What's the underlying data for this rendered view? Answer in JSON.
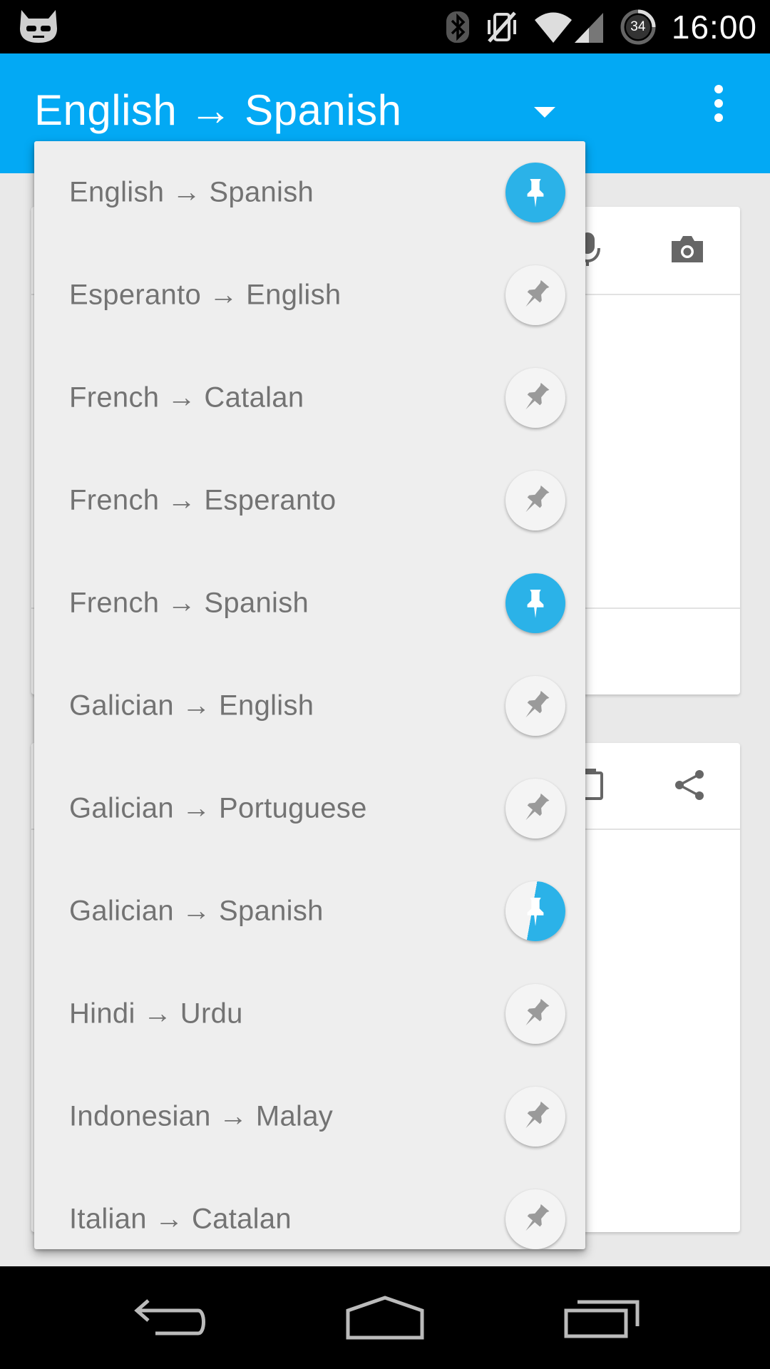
{
  "status_bar": {
    "time": "16:00",
    "battery_level": "34",
    "icons": [
      "cyanogenmod-icon",
      "bluetooth-icon",
      "vibrate-off-icon",
      "wifi-icon",
      "signal-icon",
      "battery-icon"
    ]
  },
  "toolbar": {
    "title": "English → Spanish",
    "background": "#03a9f4"
  },
  "input_card": {
    "icons": [
      "microphone-icon",
      "camera-icon"
    ]
  },
  "output_card": {
    "icons": [
      "copy-icon",
      "share-icon"
    ]
  },
  "dropdown": {
    "items": [
      {
        "label": "English → Spanish",
        "pinned": true
      },
      {
        "label": "Esperanto → English",
        "pinned": false
      },
      {
        "label": "French → Catalan",
        "pinned": false
      },
      {
        "label": "French → Esperanto",
        "pinned": false
      },
      {
        "label": "French → Spanish",
        "pinned": true
      },
      {
        "label": "Galician → English",
        "pinned": false
      },
      {
        "label": "Galician → Portuguese",
        "pinned": false
      },
      {
        "label": "Galician → Spanish",
        "pinned": "transitioning"
      },
      {
        "label": "Hindi → Urdu",
        "pinned": false
      },
      {
        "label": "Indonesian → Malay",
        "pinned": false
      },
      {
        "label": "Italian → Catalan",
        "pinned": false
      }
    ],
    "pin_on_color": "#2bb2e8"
  },
  "nav_bar": {
    "icons": [
      "back-icon",
      "home-icon",
      "recents-icon"
    ]
  }
}
